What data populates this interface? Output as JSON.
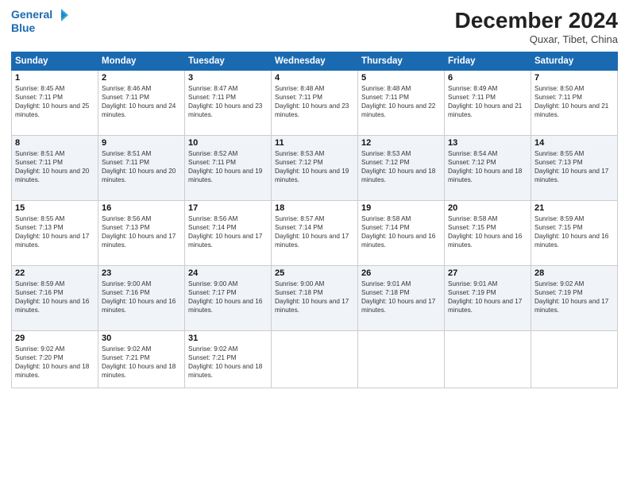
{
  "header": {
    "logo_line1": "General",
    "logo_line2": "Blue",
    "month_title": "December 2024",
    "location": "Quxar, Tibet, China"
  },
  "days_of_week": [
    "Sunday",
    "Monday",
    "Tuesday",
    "Wednesday",
    "Thursday",
    "Friday",
    "Saturday"
  ],
  "weeks": [
    [
      {
        "day": "1",
        "sunrise": "8:45 AM",
        "sunset": "7:11 PM",
        "daylight": "10 hours and 25 minutes."
      },
      {
        "day": "2",
        "sunrise": "8:46 AM",
        "sunset": "7:11 PM",
        "daylight": "10 hours and 24 minutes."
      },
      {
        "day": "3",
        "sunrise": "8:47 AM",
        "sunset": "7:11 PM",
        "daylight": "10 hours and 23 minutes."
      },
      {
        "day": "4",
        "sunrise": "8:48 AM",
        "sunset": "7:11 PM",
        "daylight": "10 hours and 23 minutes."
      },
      {
        "day": "5",
        "sunrise": "8:48 AM",
        "sunset": "7:11 PM",
        "daylight": "10 hours and 22 minutes."
      },
      {
        "day": "6",
        "sunrise": "8:49 AM",
        "sunset": "7:11 PM",
        "daylight": "10 hours and 21 minutes."
      },
      {
        "day": "7",
        "sunrise": "8:50 AM",
        "sunset": "7:11 PM",
        "daylight": "10 hours and 21 minutes."
      }
    ],
    [
      {
        "day": "8",
        "sunrise": "8:51 AM",
        "sunset": "7:11 PM",
        "daylight": "10 hours and 20 minutes."
      },
      {
        "day": "9",
        "sunrise": "8:51 AM",
        "sunset": "7:11 PM",
        "daylight": "10 hours and 20 minutes."
      },
      {
        "day": "10",
        "sunrise": "8:52 AM",
        "sunset": "7:11 PM",
        "daylight": "10 hours and 19 minutes."
      },
      {
        "day": "11",
        "sunrise": "8:53 AM",
        "sunset": "7:12 PM",
        "daylight": "10 hours and 19 minutes."
      },
      {
        "day": "12",
        "sunrise": "8:53 AM",
        "sunset": "7:12 PM",
        "daylight": "10 hours and 18 minutes."
      },
      {
        "day": "13",
        "sunrise": "8:54 AM",
        "sunset": "7:12 PM",
        "daylight": "10 hours and 18 minutes."
      },
      {
        "day": "14",
        "sunrise": "8:55 AM",
        "sunset": "7:13 PM",
        "daylight": "10 hours and 17 minutes."
      }
    ],
    [
      {
        "day": "15",
        "sunrise": "8:55 AM",
        "sunset": "7:13 PM",
        "daylight": "10 hours and 17 minutes."
      },
      {
        "day": "16",
        "sunrise": "8:56 AM",
        "sunset": "7:13 PM",
        "daylight": "10 hours and 17 minutes."
      },
      {
        "day": "17",
        "sunrise": "8:56 AM",
        "sunset": "7:14 PM",
        "daylight": "10 hours and 17 minutes."
      },
      {
        "day": "18",
        "sunrise": "8:57 AM",
        "sunset": "7:14 PM",
        "daylight": "10 hours and 17 minutes."
      },
      {
        "day": "19",
        "sunrise": "8:58 AM",
        "sunset": "7:14 PM",
        "daylight": "10 hours and 16 minutes."
      },
      {
        "day": "20",
        "sunrise": "8:58 AM",
        "sunset": "7:15 PM",
        "daylight": "10 hours and 16 minutes."
      },
      {
        "day": "21",
        "sunrise": "8:59 AM",
        "sunset": "7:15 PM",
        "daylight": "10 hours and 16 minutes."
      }
    ],
    [
      {
        "day": "22",
        "sunrise": "8:59 AM",
        "sunset": "7:16 PM",
        "daylight": "10 hours and 16 minutes."
      },
      {
        "day": "23",
        "sunrise": "9:00 AM",
        "sunset": "7:16 PM",
        "daylight": "10 hours and 16 minutes."
      },
      {
        "day": "24",
        "sunrise": "9:00 AM",
        "sunset": "7:17 PM",
        "daylight": "10 hours and 16 minutes."
      },
      {
        "day": "25",
        "sunrise": "9:00 AM",
        "sunset": "7:18 PM",
        "daylight": "10 hours and 17 minutes."
      },
      {
        "day": "26",
        "sunrise": "9:01 AM",
        "sunset": "7:18 PM",
        "daylight": "10 hours and 17 minutes."
      },
      {
        "day": "27",
        "sunrise": "9:01 AM",
        "sunset": "7:19 PM",
        "daylight": "10 hours and 17 minutes."
      },
      {
        "day": "28",
        "sunrise": "9:02 AM",
        "sunset": "7:19 PM",
        "daylight": "10 hours and 17 minutes."
      }
    ],
    [
      {
        "day": "29",
        "sunrise": "9:02 AM",
        "sunset": "7:20 PM",
        "daylight": "10 hours and 18 minutes."
      },
      {
        "day": "30",
        "sunrise": "9:02 AM",
        "sunset": "7:21 PM",
        "daylight": "10 hours and 18 minutes."
      },
      {
        "day": "31",
        "sunrise": "9:02 AM",
        "sunset": "7:21 PM",
        "daylight": "10 hours and 18 minutes."
      },
      null,
      null,
      null,
      null
    ]
  ]
}
